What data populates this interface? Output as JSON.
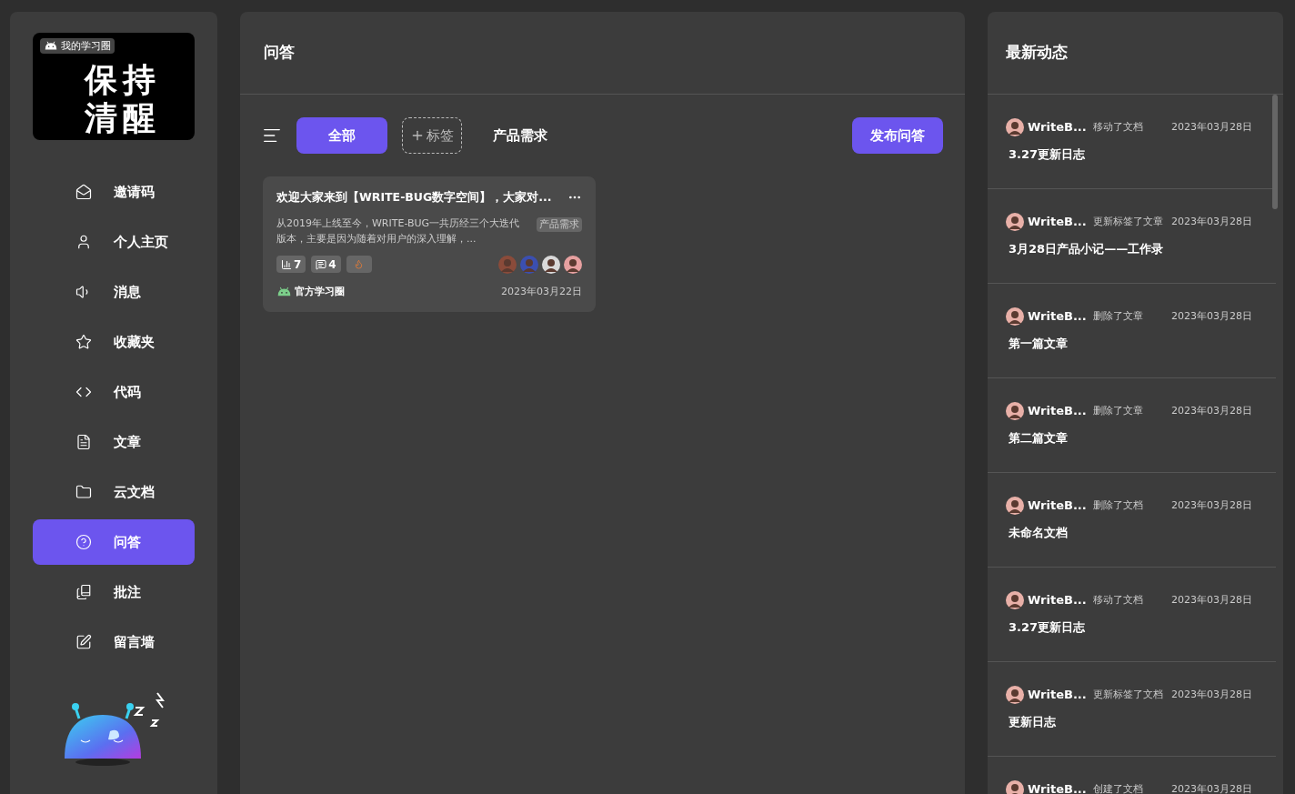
{
  "logo": {
    "badge": "我的学习圈",
    "lines": [
      "保持",
      "清醒"
    ]
  },
  "nav": [
    {
      "label": "邀请码",
      "selected": false
    },
    {
      "label": "个人主页",
      "selected": false
    },
    {
      "label": "消息",
      "selected": false
    },
    {
      "label": "收藏夹",
      "selected": false
    },
    {
      "label": "代码",
      "selected": false
    },
    {
      "label": "文章",
      "selected": false
    },
    {
      "label": "云文档",
      "selected": false
    },
    {
      "label": "问答",
      "selected": true
    },
    {
      "label": "批注",
      "selected": false
    },
    {
      "label": "留言墙",
      "selected": false
    }
  ],
  "main": {
    "title": "问答",
    "filters": [
      {
        "label": "全部",
        "selected": true
      },
      {
        "label": "产品需求",
        "selected": false
      }
    ],
    "add_tag": "标签",
    "publish": "发布问答",
    "cards": [
      {
        "title": "欢迎大家来到【WRITE-BUG数字空间】，大家对...",
        "description": "从2019年上线至今，WRITE-BUG一共历经三个大迭代版本，主要是因为随着对用户的深入理解，...",
        "tag": "产品需求",
        "likes": "7",
        "comments": "4",
        "avatars": [
          {
            "color": "#8a4b3a"
          },
          {
            "color": "#3b4fb0"
          },
          {
            "color": "#d9d9d9"
          },
          {
            "color": "#e6a0a0"
          }
        ],
        "circle": "官方学习圈",
        "date": "2023年03月22日"
      }
    ]
  },
  "feed": {
    "title": "最新动态",
    "items": [
      {
        "user": "WriteB...",
        "action": "移动了文档",
        "date": "2023年03月28日",
        "target": "3.27更新日志"
      },
      {
        "user": "WriteB...",
        "action": "更新标签了文章",
        "date": "2023年03月28日",
        "target": "3月28日产品小记——工作录"
      },
      {
        "user": "WriteB...",
        "action": "删除了文章",
        "date": "2023年03月28日",
        "target": "第一篇文章"
      },
      {
        "user": "WriteB...",
        "action": "删除了文章",
        "date": "2023年03月28日",
        "target": "第二篇文章"
      },
      {
        "user": "WriteB...",
        "action": "删除了文档",
        "date": "2023年03月28日",
        "target": "未命名文档"
      },
      {
        "user": "WriteB...",
        "action": "移动了文档",
        "date": "2023年03月28日",
        "target": "3.27更新日志"
      },
      {
        "user": "WriteB...",
        "action": "更新标签了文档",
        "date": "2023年03月28日",
        "target": "更新日志"
      },
      {
        "user": "WriteB...",
        "action": "创建了文档",
        "date": "2023年03月28日"
      }
    ]
  }
}
